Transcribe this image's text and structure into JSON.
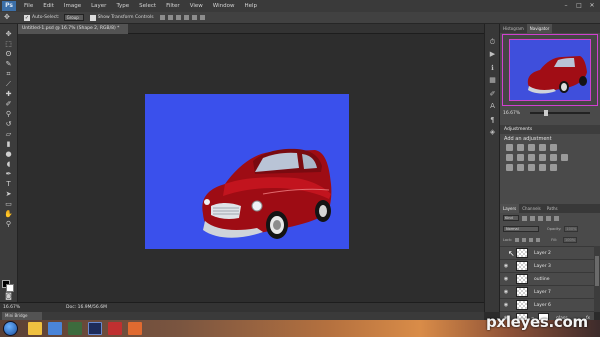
{
  "app": {
    "logo": "Ps"
  },
  "menu": [
    "File",
    "Edit",
    "Image",
    "Layer",
    "Type",
    "Select",
    "Filter",
    "View",
    "Window",
    "Help"
  ],
  "options": {
    "auto_select_label": "Auto-Select:",
    "auto_select_value": "Group",
    "transform_label": "Show Transform Controls",
    "workspace": "Photography"
  },
  "document": {
    "tab_title": "Untitled-1.psd @ 16.7% (Shape 2, RGB/8) *",
    "canvas_color": "#3a50ec"
  },
  "navigator": {
    "tabs": [
      "Histogram",
      "Navigator"
    ],
    "zoom": "16.67%"
  },
  "adjustments": {
    "header": "Adjustments",
    "title": "Add an adjustment"
  },
  "layers_panel": {
    "tabs": [
      "Layers",
      "Channels",
      "Paths"
    ],
    "kind": "Kind",
    "blend_mode": "Normal",
    "opacity_label": "Opacity:",
    "opacity_value": "100%",
    "lock_label": "Lock:",
    "fill_label": "Fill:",
    "fill_value": "100%",
    "layers": [
      {
        "name": "Layer 2",
        "visible": false
      },
      {
        "name": "Layer 3",
        "visible": true
      },
      {
        "name": "outline",
        "visible": true
      },
      {
        "name": "Layer 7",
        "visible": true
      },
      {
        "name": "Layer 6",
        "visible": true
      },
      {
        "name": "glass",
        "visible": true,
        "mask": true,
        "fx": "fx"
      }
    ]
  },
  "status": {
    "zoom": "16.67%",
    "doc": "Doc: 16.9M/56.6M"
  },
  "mini_bridge": "Mini Bridge",
  "watermark": "pxleyes.com"
}
